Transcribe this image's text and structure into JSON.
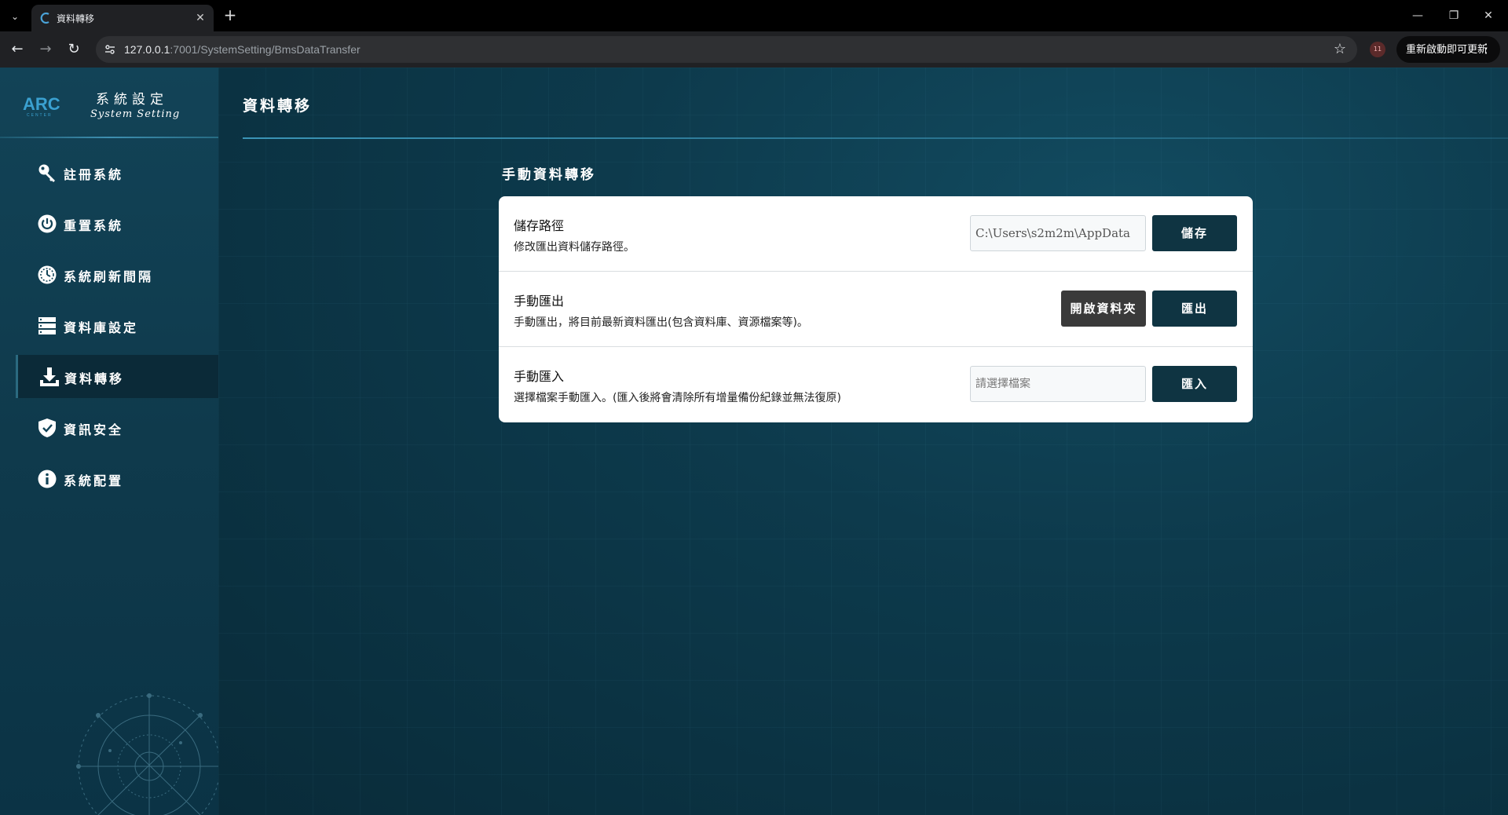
{
  "browser": {
    "tab_title": "資料轉移",
    "url_host": "127.0.0.1",
    "url_path": ":7001/SystemSetting/BmsDataTransfer",
    "extension_badge": "11",
    "update_label": "重新啟動即可更新"
  },
  "brand": {
    "logo_text": "ARC",
    "logo_sub": "CENTER",
    "title_cn": "系統設定",
    "title_en": "System Setting"
  },
  "sidebar": {
    "items": [
      {
        "label": "註冊系統",
        "icon": "key-icon"
      },
      {
        "label": "重置系統",
        "icon": "power-icon"
      },
      {
        "label": "系統刷新間隔",
        "icon": "timer-icon"
      },
      {
        "label": "資料庫設定",
        "icon": "database-icon"
      },
      {
        "label": "資料轉移",
        "icon": "download-icon",
        "active": true
      },
      {
        "label": "資訊安全",
        "icon": "shield-icon"
      },
      {
        "label": "系統配置",
        "icon": "info-icon"
      }
    ]
  },
  "main": {
    "page_title": "資料轉移",
    "section_title": "手動資料轉移",
    "rows": [
      {
        "title": "儲存路徑",
        "desc": "修改匯出資料儲存路徑。",
        "field_value": "C:\\Users\\s2m2m\\AppData",
        "button": "儲存"
      },
      {
        "title": "手動匯出",
        "desc": "手動匯出，將目前最新資料匯出(包含資料庫、資源檔案等)。",
        "secondary_button": "開啟資料夾",
        "button": "匯出"
      },
      {
        "title": "手動匯入",
        "desc": "選擇檔案手動匯入。(匯入後將會清除所有增量備份紀錄並無法復原)",
        "field_placeholder": "請選擇檔案",
        "button": "匯入"
      }
    ]
  },
  "colors": {
    "sidebar_bg": "#124357",
    "active_item_bg": "#0b2a38",
    "primary_button": "#0f3442",
    "secondary_button": "#3a3a3a",
    "accent_line": "#3b95b7"
  }
}
